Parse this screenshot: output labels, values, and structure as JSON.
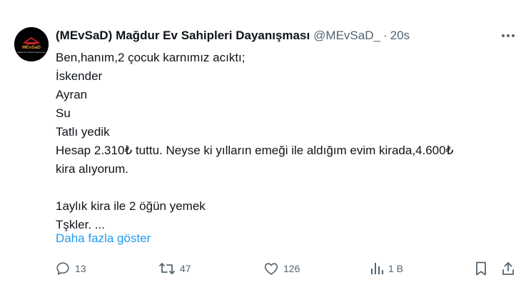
{
  "author": {
    "display_name": "(MEvSaD) Mağdur Ev Sahipleri Dayanışması",
    "handle": "@MEvSaD_",
    "separator": "·",
    "time": "20s",
    "avatar_text": "MEvSaD",
    "avatar_subtext": "Mağdur Ev Sahipleri Dayanışması"
  },
  "tweet": {
    "lines": [
      "Ben,hanım,2 çocuk karnımız acıktı;",
      "İskender",
      "Ayran",
      "Su",
      "Tatlı yedik",
      "Hesap 2.310₺ tuttu. Neyse ki yılların emeği ile aldığım evim kirada,4.600₺",
      "kira alıyorum.",
      "",
      "1aylık kira ile 2 öğün yemek",
      "Tşkler. ..."
    ],
    "show_more_label": "Daha fazla göster"
  },
  "actions": {
    "reply": {
      "icon": "reply-icon",
      "count": "13"
    },
    "retweet": {
      "icon": "retweet-icon",
      "count": "47"
    },
    "like": {
      "icon": "like-icon",
      "count": "126"
    },
    "views": {
      "icon": "views-icon",
      "count": "1 B"
    },
    "bookmark": {
      "icon": "bookmark-icon"
    },
    "share": {
      "icon": "share-icon"
    },
    "more": {
      "icon": "more-icon"
    }
  },
  "colors": {
    "text": "#0f1419",
    "secondary": "#536471",
    "link": "#1d9bf0",
    "background": "#ffffff",
    "avatar_bg": "#000000",
    "avatar_accent": "#e0242b"
  }
}
